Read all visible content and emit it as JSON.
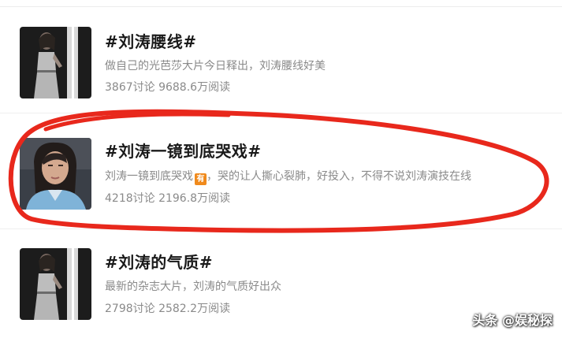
{
  "topics": [
    {
      "title": "#刘涛腰线#",
      "description": "做自己的光芭莎大片今日释出，刘涛腰线好美",
      "stats": "3867讨论 9688.6万阅读",
      "thumb_icon": "fashion-photo"
    },
    {
      "title": "#刘涛一镜到底哭戏#",
      "description_before_badge": "刘涛一镜到底哭戏",
      "badge": "有",
      "description_after_badge": "，哭的让人撕心裂肺，好投入，不得不说刘涛演技在线",
      "stats": "4218讨论 2196.8万阅读",
      "thumb_icon": "portrait-photo"
    },
    {
      "title": "#刘涛的气质#",
      "description": "最新的杂志大片，刘涛的气质好出众",
      "stats": "2798讨论 2582.2万阅读",
      "thumb_icon": "fashion-photo"
    }
  ],
  "watermark": "头条 @娱秘探",
  "colors": {
    "title": "#1a1a1a",
    "meta": "#8a8a8a",
    "annotation_circle": "#e8281c",
    "badge": "#f08a1c"
  }
}
